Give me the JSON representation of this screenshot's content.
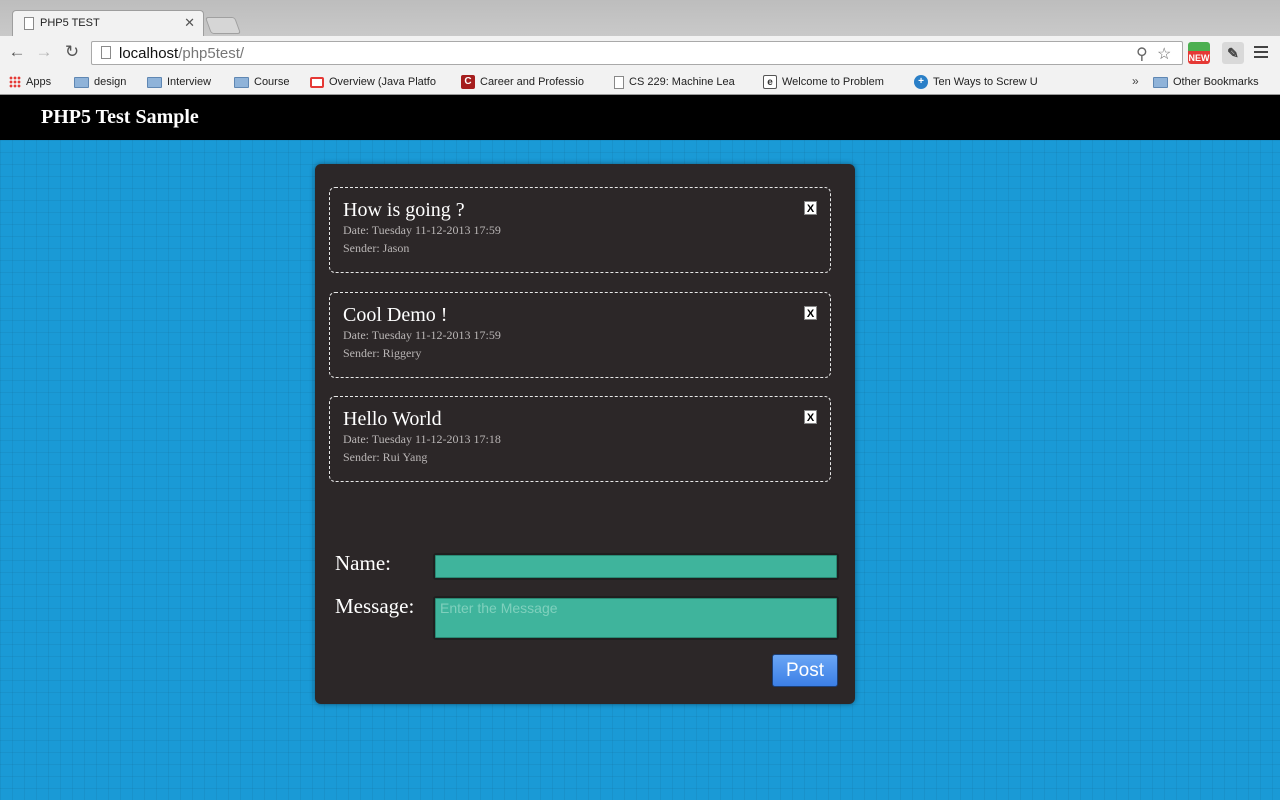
{
  "browser": {
    "tab": {
      "title": "PHP5 TEST"
    },
    "url": {
      "host": "localhost",
      "path": "/php5test/"
    },
    "bookmarks": [
      {
        "label": "Apps",
        "icon": "apps-icon"
      },
      {
        "label": "design",
        "icon": "folder-icon"
      },
      {
        "label": "Interview",
        "icon": "folder-icon"
      },
      {
        "label": "Course",
        "icon": "folder-icon"
      },
      {
        "label": "Overview (Java Platfo",
        "icon": "oracle-icon"
      },
      {
        "label": "Career and Professio",
        "icon": "c-icon"
      },
      {
        "label": "CS 229: Machine Lea",
        "icon": "page-icon"
      },
      {
        "label": "Welcome to Problem",
        "icon": "site-icon"
      },
      {
        "label": "Ten Ways to Screw U",
        "icon": "globe-icon"
      }
    ],
    "more_bookmarks": "»",
    "other_bookmarks": "Other Bookmarks",
    "extension_badge": "NEW"
  },
  "page": {
    "site_title": "PHP5 Test Sample",
    "messages": [
      {
        "title": "How is going ?",
        "date": "Date: Tuesday 11-12-2013 17:59",
        "sender": "Sender: Jason",
        "delete_label": "X"
      },
      {
        "title": "Cool Demo !",
        "date": "Date: Tuesday 11-12-2013 17:59",
        "sender": "Sender: Riggery",
        "delete_label": "X"
      },
      {
        "title": "Hello World",
        "date": "Date: Tuesday 11-12-2013 17:18",
        "sender": "Sender: Rui Yang",
        "delete_label": "X"
      }
    ],
    "form": {
      "name_label": "Name:",
      "name_value": "",
      "message_label": "Message:",
      "message_placeholder": "Enter the Message",
      "post_label": "Post"
    }
  },
  "colors": {
    "page_background": "#1a9ad6",
    "panel_background": "#2c2728",
    "field_background": "#3fb49c",
    "post_button": "#4a8cee"
  }
}
